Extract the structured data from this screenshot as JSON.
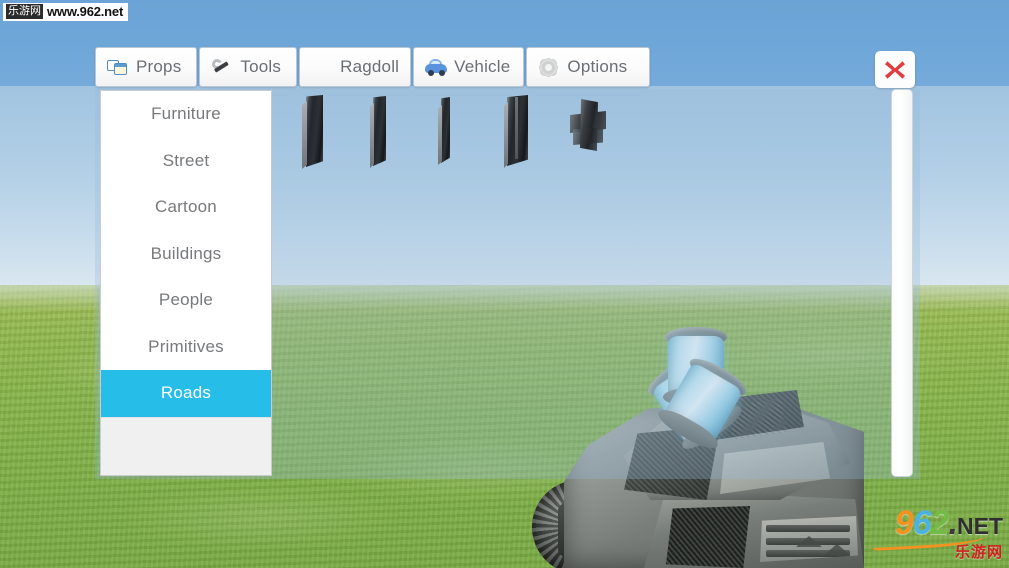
{
  "watermarks": {
    "top": {
      "cn": "乐游网",
      "url": "www.962.net"
    },
    "logo": {
      "d9": "9",
      "d6": "6",
      "d2": "2",
      "dot": ".",
      "net": "NET",
      "sub": "乐游网"
    }
  },
  "toolbar": {
    "tabs": [
      {
        "label": "Props",
        "icon": "props-windows-icon",
        "active": true
      },
      {
        "label": "Tools",
        "icon": "wrench-icon",
        "active": false
      },
      {
        "label": "Ragdoll",
        "icon": "people-group-icon",
        "active": false
      },
      {
        "label": "Vehicle",
        "icon": "car-icon",
        "active": false
      },
      {
        "label": "Options",
        "icon": "gear-icon",
        "active": false
      }
    ],
    "close_label": "Close"
  },
  "sidebar": {
    "items": [
      {
        "label": "Furniture",
        "selected": false
      },
      {
        "label": "Street",
        "selected": false
      },
      {
        "label": "Cartoon",
        "selected": false
      },
      {
        "label": "Buildings",
        "selected": false
      },
      {
        "label": "People",
        "selected": false
      },
      {
        "label": "Primitives",
        "selected": false
      },
      {
        "label": "Roads",
        "selected": true
      }
    ],
    "selected": "Roads"
  },
  "thumbnails": [
    {
      "name": "road-straight-wide",
      "kind": "slab"
    },
    {
      "name": "road-straight-medium",
      "kind": "slab"
    },
    {
      "name": "road-straight-narrow",
      "kind": "slab"
    },
    {
      "name": "road-straight-double",
      "kind": "slab"
    },
    {
      "name": "road-intersection",
      "kind": "cross"
    }
  ],
  "colors": {
    "accent": "#26bde8",
    "tab_text": "#6a6f74",
    "sidebar_text": "#77797c",
    "close_x": "#e23c3c",
    "sky_top": "#6ba3d6",
    "sky_bottom": "#d9e6ef",
    "ground": "#85b348",
    "thruster_glow": "#7fd6ef"
  },
  "scene": {
    "vehicle": "armored-hover-tank",
    "thruster_count": 3
  },
  "scrollbar": {
    "position": "top",
    "orientation": "vertical"
  }
}
